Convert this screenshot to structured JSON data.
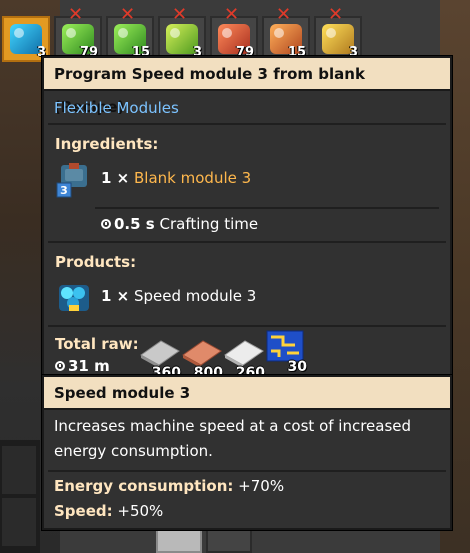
{
  "quickbar": {
    "slots": [
      {
        "count": "3",
        "tier": "speed",
        "selected": true
      },
      {
        "count": "79",
        "tier": "efficiency",
        "selected": false
      },
      {
        "count": "15",
        "tier": "efficiency",
        "selected": false
      },
      {
        "count": "3",
        "tier": "efficiency",
        "selected": false
      },
      {
        "count": "79",
        "tier": "productivity",
        "selected": false
      },
      {
        "count": "15",
        "tier": "productivity",
        "selected": false
      },
      {
        "count": "3",
        "tier": "productivity",
        "selected": false
      }
    ]
  },
  "recipe_tooltip": {
    "title": "Program Speed module 3 from blank (Recipe)",
    "group": "Flexible Modules",
    "ingredients_heading": "Ingredients:",
    "ingredient": {
      "amount": "1 ×",
      "name": "Blank module 3",
      "badge": "3",
      "icon": "blank-module-3-icon"
    },
    "crafting_time_value": "0.5 s",
    "crafting_time_label": "Crafting time",
    "products_heading": "Products:",
    "product": {
      "amount": "1 ×",
      "name": "Speed module 3",
      "icon": "speed-module-3-icon"
    },
    "total_raw_label": "Total raw:",
    "total_raw_time": "31 m",
    "raw_items": [
      {
        "icon": "steel-plate-icon",
        "count": "360"
      },
      {
        "icon": "copper-plate-icon",
        "count": "800"
      },
      {
        "icon": "iron-plate-icon",
        "count": "260"
      },
      {
        "icon": "circuit-icon",
        "count": "30"
      }
    ]
  },
  "item_tooltip": {
    "title": "Speed module 3",
    "description": "Increases machine speed at a cost of increased energy consumption.",
    "energy_label": "Energy consumption:",
    "energy_value": "+70%",
    "speed_label": "Speed:",
    "speed_value": "+50%"
  },
  "colors": {
    "title_bg": "#f2dfc0",
    "group_link": "#7cc3ff",
    "ingredient_name": "#ffb84d",
    "heading": "#ffe6c0",
    "tooltip_bg": "#313131"
  }
}
